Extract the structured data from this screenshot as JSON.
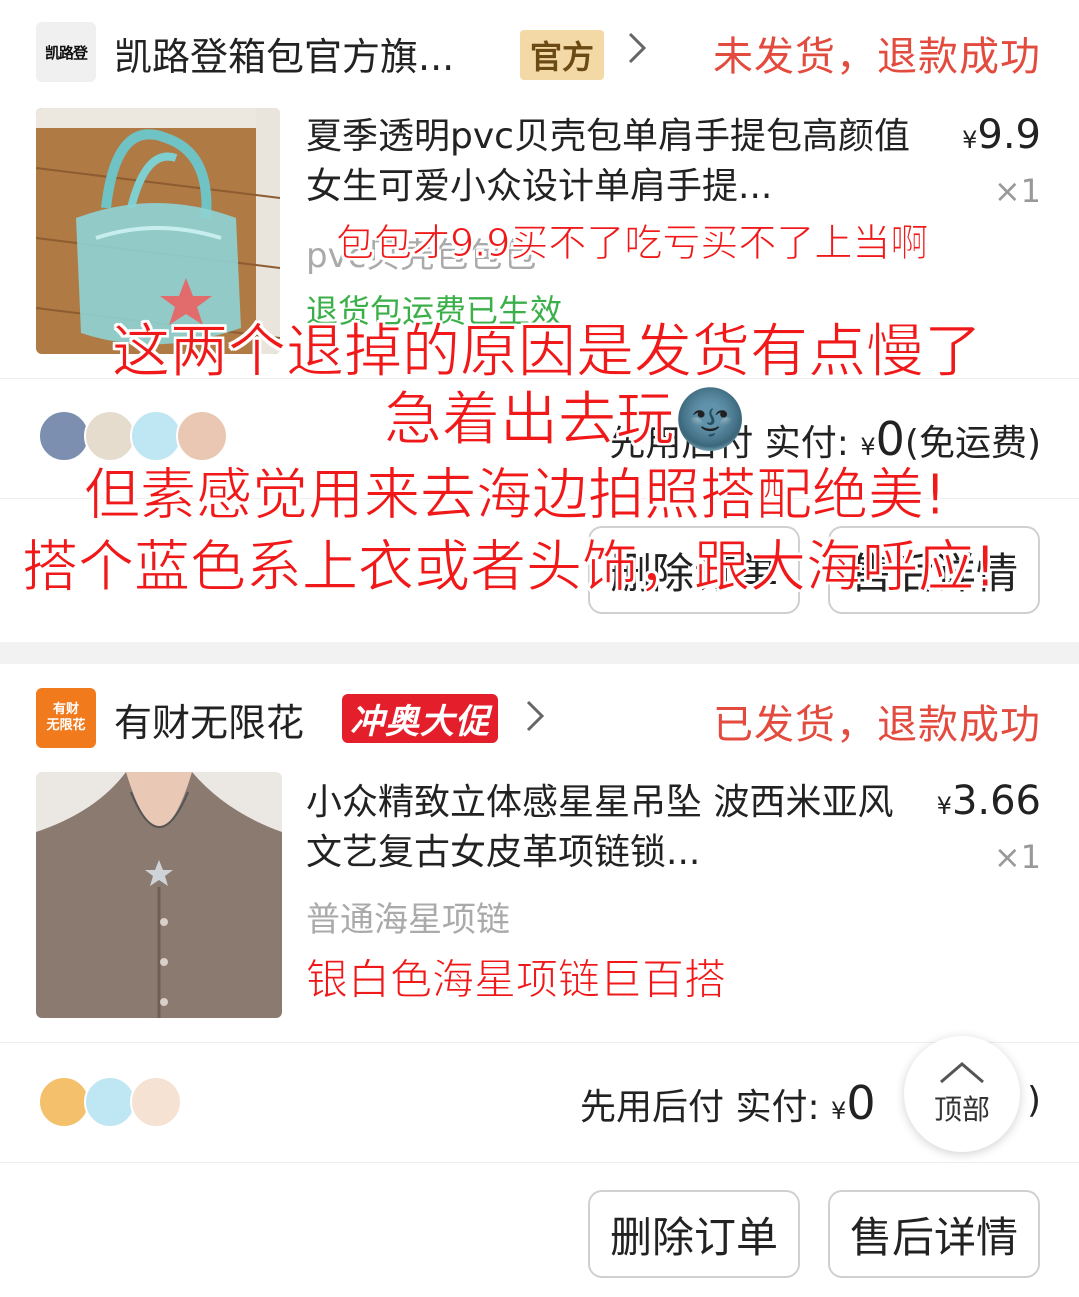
{
  "order1": {
    "shop_logo_text": "凯路登",
    "shop_name": "凯路登箱包官方旗...",
    "badge": "官方",
    "status": "未发货，退款成功",
    "title": "夏季透明pvc贝壳包单肩手提包高颜值女生可爱小众设计单肩手提...",
    "price_symbol": "¥",
    "price_value": "9.9",
    "qty": "×1",
    "spec": "pvc贝壳包包包",
    "notice": "退货包运费已生效",
    "pay_text": "先用后付 实付:",
    "pay_symbol": "¥",
    "pay_amount": "0",
    "pay_note": "(免运费)",
    "btn_delete": "删除订单",
    "btn_after_sale": "售后详情"
  },
  "order2": {
    "shop_logo_line1": "有财",
    "shop_logo_line2": "无限花",
    "shop_name": "有财无限花",
    "badge": "冲奥大促",
    "status": "已发货，退款成功",
    "title": "小众精致立体感星星吊坠 波西米亚风文艺复古女皮革项链锁...",
    "price_symbol": "¥",
    "price_value": "3.66",
    "qty": "×1",
    "spec": "普通海星项链",
    "pay_text": "先用后付 实付:",
    "pay_symbol": "¥",
    "pay_amount": "0",
    "pay_note_tail": ")",
    "btn_delete": "删除订单",
    "btn_after_sale": "售后详情"
  },
  "back_to_top": "顶部",
  "annotations": {
    "line1": "包包才9.9买不了吃亏买不了上当啊",
    "line2": "这两个退掉的原因是发货有点慢了",
    "line3": "急着出去玩",
    "line3_emoji": "🌚",
    "line4": "但素感觉用来去海边拍照搭配绝美!",
    "line5": "搭个蓝色系上衣或者头饰，跟大海呼应!",
    "line6": "银白色海星项链巨百搭"
  },
  "colors": {
    "status_red": "#e34b3f",
    "annotation_red": "#f01818",
    "official_badge_bg": "#f3d9a6",
    "promo_badge_bg": "#e41e2a",
    "notice_green": "#3bb04a"
  }
}
